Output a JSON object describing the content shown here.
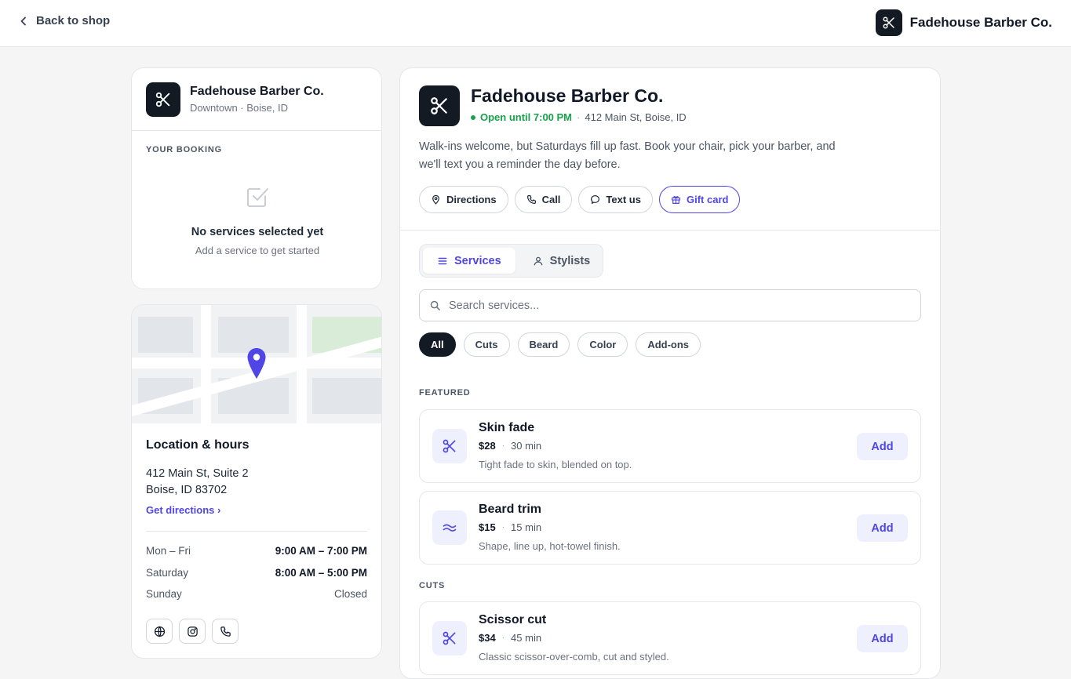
{
  "topbar": {
    "back_label": "Back to shop",
    "brand_name": "Fadehouse Barber Co.",
    "brand_icon": "scissors-icon"
  },
  "booking": {
    "shop_name": "Fadehouse Barber Co.",
    "shop_location": "Downtown · Boise, ID",
    "section_label": "YOUR BOOKING",
    "empty_icon": "checkbox-icon",
    "empty_title": "No services selected yet",
    "empty_subtitle": "Add a service to get started"
  },
  "location": {
    "title": "Location & hours",
    "address_line1": "412 Main St, Suite 2",
    "address_line2": "Boise, ID 83702",
    "directions_link": "Get directions ›",
    "hours": [
      {
        "day": "Mon – Fri",
        "time": "9:00 AM – 7:00 PM"
      },
      {
        "day": "Saturday",
        "time": "8:00 AM – 5:00 PM"
      },
      {
        "day": "Sunday",
        "time": "Closed"
      }
    ],
    "social_icons": [
      "globe-icon",
      "instagram-icon",
      "phone-icon"
    ]
  },
  "main": {
    "title": "Fadehouse Barber Co.",
    "status_open": "Open until 7:00 PM",
    "status_sep": "·",
    "status_address": "412 Main St, Boise, ID",
    "description": "Walk-ins welcome, but Saturdays fill up fast. Book your chair, pick your barber, and we'll text you a reminder the day before.",
    "actions": [
      {
        "label": "Directions",
        "icon": "map-pin-icon"
      },
      {
        "label": "Call",
        "icon": "phone-icon"
      },
      {
        "label": "Text us",
        "icon": "chat-icon"
      },
      {
        "label": "Gift card",
        "icon": "gift-icon"
      }
    ],
    "tabs": [
      {
        "label": "Services",
        "icon": "list-icon",
        "active": true
      },
      {
        "label": "Stylists",
        "icon": "person-icon",
        "active": false
      }
    ],
    "search_placeholder": "Search services...",
    "filters": [
      "All",
      "Cuts",
      "Beard",
      "Color",
      "Add-ons"
    ],
    "active_filter": "All",
    "groups": [
      {
        "label": "FEATURED",
        "services": [
          {
            "name": "Skin fade",
            "price": "$28",
            "duration": "30 min",
            "desc": "Tight fade to skin, blended on top.",
            "icon": "scissors-icon",
            "add_label": "Add"
          },
          {
            "name": "Beard trim",
            "price": "$15",
            "duration": "15 min",
            "desc": "Shape, line up, hot-towel finish.",
            "icon": "wave-icon",
            "add_label": "Add"
          }
        ]
      },
      {
        "label": "CUTS",
        "services": [
          {
            "name": "Scissor cut",
            "price": "$34",
            "duration": "45 min",
            "desc": "Classic scissor-over-comb, cut and styled.",
            "icon": "scissors-icon",
            "add_label": "Add"
          }
        ]
      }
    ]
  },
  "colors": {
    "accent": "#4f46e5",
    "dark": "#141a24",
    "open_green": "#16a34a",
    "accent_tint": "#eef0fd"
  }
}
